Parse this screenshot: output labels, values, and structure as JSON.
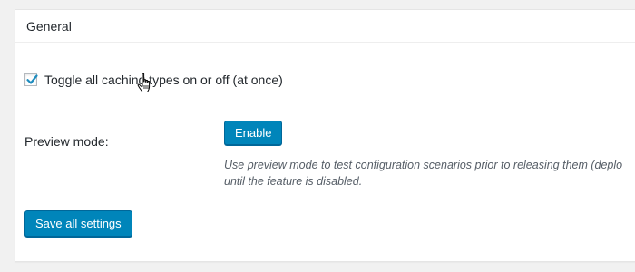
{
  "section": {
    "title": "General"
  },
  "toggle_all": {
    "label": "Toggle all caching types on or off (at once)",
    "checked": true
  },
  "preview_mode": {
    "label": "Preview mode:",
    "button_label": "Enable",
    "description_line1": "Use preview mode to test configuration scenarios prior to releasing them (deplo",
    "description_line2": "until the feature is disabled."
  },
  "footer": {
    "save_label": "Save all settings"
  },
  "colors": {
    "primary_button": "#0085ba",
    "primary_button_border": "#006799",
    "checkmark": "#1e8cbe",
    "page_background": "#f1f1f1"
  },
  "icons": {
    "checkbox_mark": "checkmark-icon",
    "pointer": "hand-pointer-icon"
  }
}
